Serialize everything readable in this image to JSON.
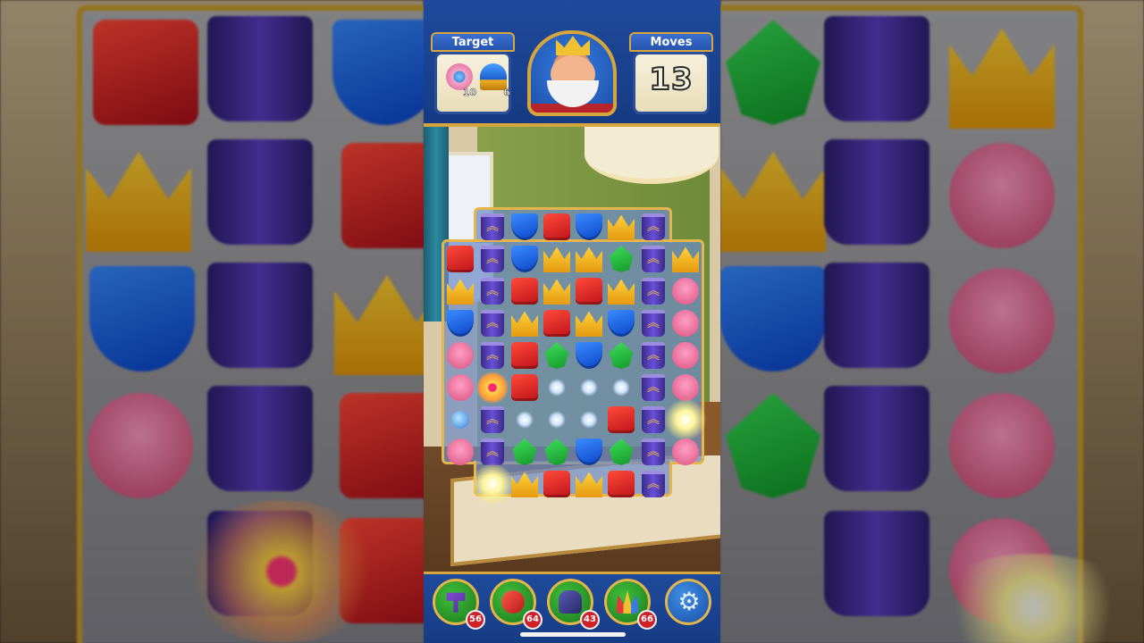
{
  "header": {
    "target_label": "Target",
    "moves_label": "Moves",
    "moves_value": "13",
    "targets": [
      {
        "icon": "pink-flower-bubble-icon",
        "count": "10"
      },
      {
        "icon": "blue-helmet-icon",
        "count": "6"
      }
    ],
    "avatar": "king-avatar"
  },
  "board": {
    "rows": [
      [
        "",
        "pot",
        "blue",
        "red",
        "blue",
        "crown",
        "pot",
        ""
      ],
      [
        "red",
        "pot",
        "blue",
        "crown",
        "crown",
        "green",
        "pot",
        "crown"
      ],
      [
        "crown",
        "pot",
        "red",
        "crown",
        "red",
        "crown",
        "pot",
        "shell"
      ],
      [
        "blue",
        "pot",
        "crown",
        "red",
        "crown",
        "blue",
        "pot",
        "shell"
      ],
      [
        "shell",
        "pot",
        "red",
        "green",
        "blue",
        "green",
        "pot",
        "shell"
      ],
      [
        "shell",
        "propeller",
        "red",
        "shard",
        "shard",
        "shard",
        "pot",
        "shell"
      ],
      [
        "orb",
        "pot",
        "shard",
        "shard",
        "shard",
        "red",
        "pot",
        "burst"
      ],
      [
        "shell",
        "pot",
        "green",
        "green",
        "blue",
        "green",
        "pot",
        "shell"
      ],
      [
        "",
        "burst",
        "crown",
        "red",
        "crown",
        "red",
        "pot",
        ""
      ]
    ]
  },
  "boosters": [
    {
      "icon": "hammer-booster-icon",
      "count": "56",
      "color": "#8a4fd8"
    },
    {
      "icon": "arrow-booster-icon",
      "count": "64",
      "color": "#d03a3a"
    },
    {
      "icon": "cannon-booster-icon",
      "count": "43",
      "color": "#3a3a8a"
    },
    {
      "icon": "jester-hat-booster-icon",
      "count": "66",
      "color": "#d8a020"
    }
  ],
  "settings_icon": "gear-icon"
}
